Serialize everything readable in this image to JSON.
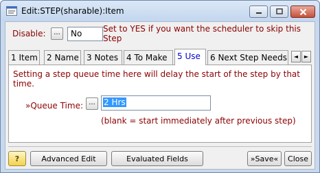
{
  "window": {
    "title": "Edit:STEP(sharable):Item",
    "controls": {
      "minimize": "—",
      "maximize": "□",
      "close": "✕"
    }
  },
  "disable": {
    "label": "Disable:",
    "dots": "...",
    "value": "No",
    "help": "Set to YES if you want the scheduler to skip this Step"
  },
  "tabs": [
    {
      "label": "1 Item"
    },
    {
      "label": "2 Name"
    },
    {
      "label": "3 Notes"
    },
    {
      "label": "4 To Make"
    },
    {
      "label": "5 Use",
      "active": true
    },
    {
      "label": "6 Next Step Needs"
    }
  ],
  "tab_scroll": {
    "left": "◄",
    "right": "►"
  },
  "panel": {
    "info": "Setting a step queue time here will delay the start of the step by that time.",
    "queue_label": "»Queue Time:",
    "queue_dots": "...",
    "queue_value": "2 Hrs",
    "queue_hint": "(blank = start immediately after previous step)"
  },
  "buttons": {
    "help": "?",
    "advanced_edit": "Advanced Edit",
    "evaluated_fields": "Evaluated Fields",
    "save": "»Save«",
    "close": "Close"
  },
  "colors": {
    "label_red": "#8b0000",
    "active_tab_blue": "#0000cc",
    "selection_blue": "#3399ff",
    "frame": "#c8d9ee"
  }
}
